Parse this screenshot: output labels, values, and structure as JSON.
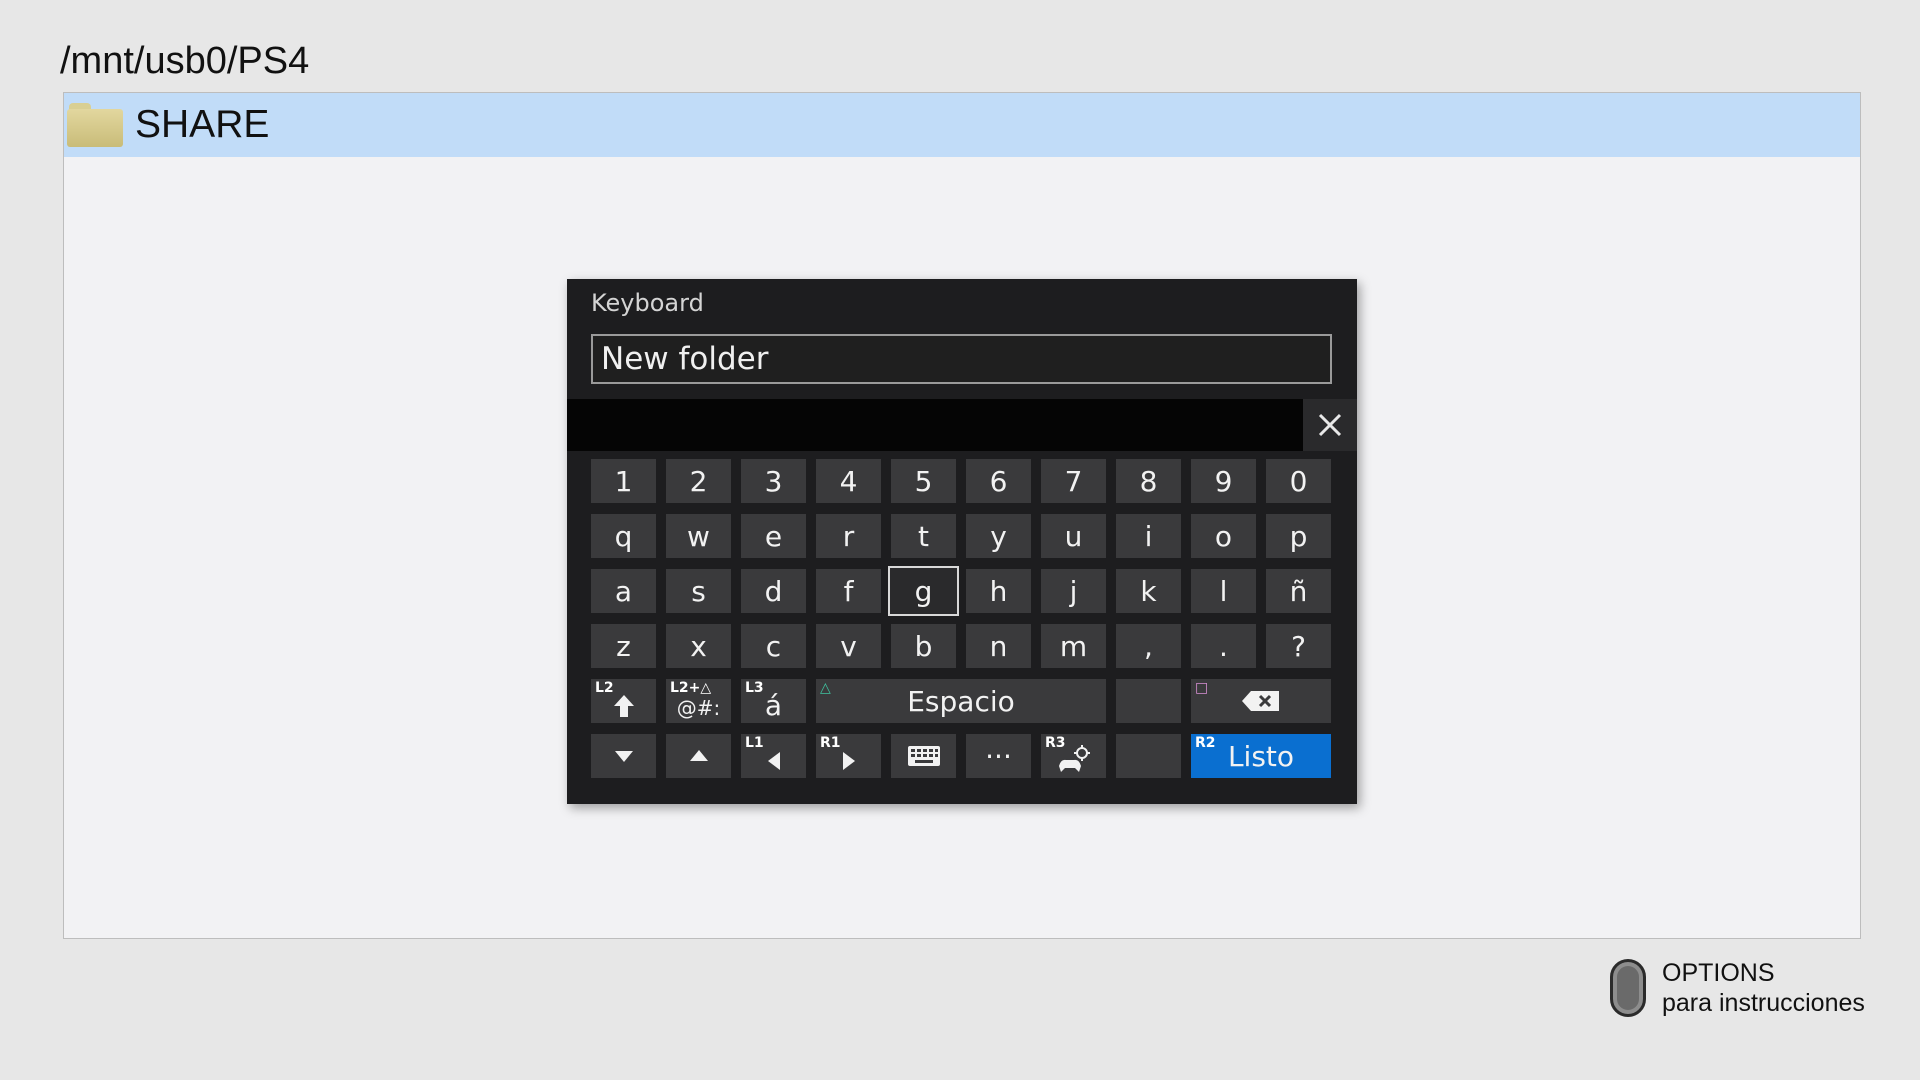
{
  "path": "/mnt/usb0/PS4",
  "files": [
    {
      "name": "SHARE",
      "icon": "folder-icon"
    }
  ],
  "keyboard": {
    "title": "Keyboard",
    "input_value": "New folder",
    "rows": [
      [
        "1",
        "2",
        "3",
        "4",
        "5",
        "6",
        "7",
        "8",
        "9",
        "0"
      ],
      [
        "q",
        "w",
        "e",
        "r",
        "t",
        "y",
        "u",
        "i",
        "o",
        "p"
      ],
      [
        "a",
        "s",
        "d",
        "f",
        "g",
        "h",
        "j",
        "k",
        "l",
        "ñ"
      ],
      [
        "z",
        "x",
        "c",
        "v",
        "b",
        "n",
        "m",
        ",",
        ".",
        "?"
      ]
    ],
    "selected_key": "g",
    "shift_badge": "L2",
    "symbols_badge": "L2+△",
    "symbols_label": "@#:",
    "accent_badge": "L3",
    "accent_label": "á",
    "space_badge": "△",
    "space_label": "Espacio",
    "backspace_badge": "□",
    "cursor_left_badge": "L1",
    "cursor_right_badge": "R1",
    "pointer_badge": "R3",
    "done_badge": "R2",
    "done_label": "Listo",
    "more_label": "···"
  },
  "options_hint": {
    "line1": "OPTIONS",
    "line2": "para instrucciones"
  },
  "colors": {
    "selected_row": "#c1dcf8",
    "done_key": "#0a6fd0",
    "keyboard_bg": "#1d1d1f"
  }
}
